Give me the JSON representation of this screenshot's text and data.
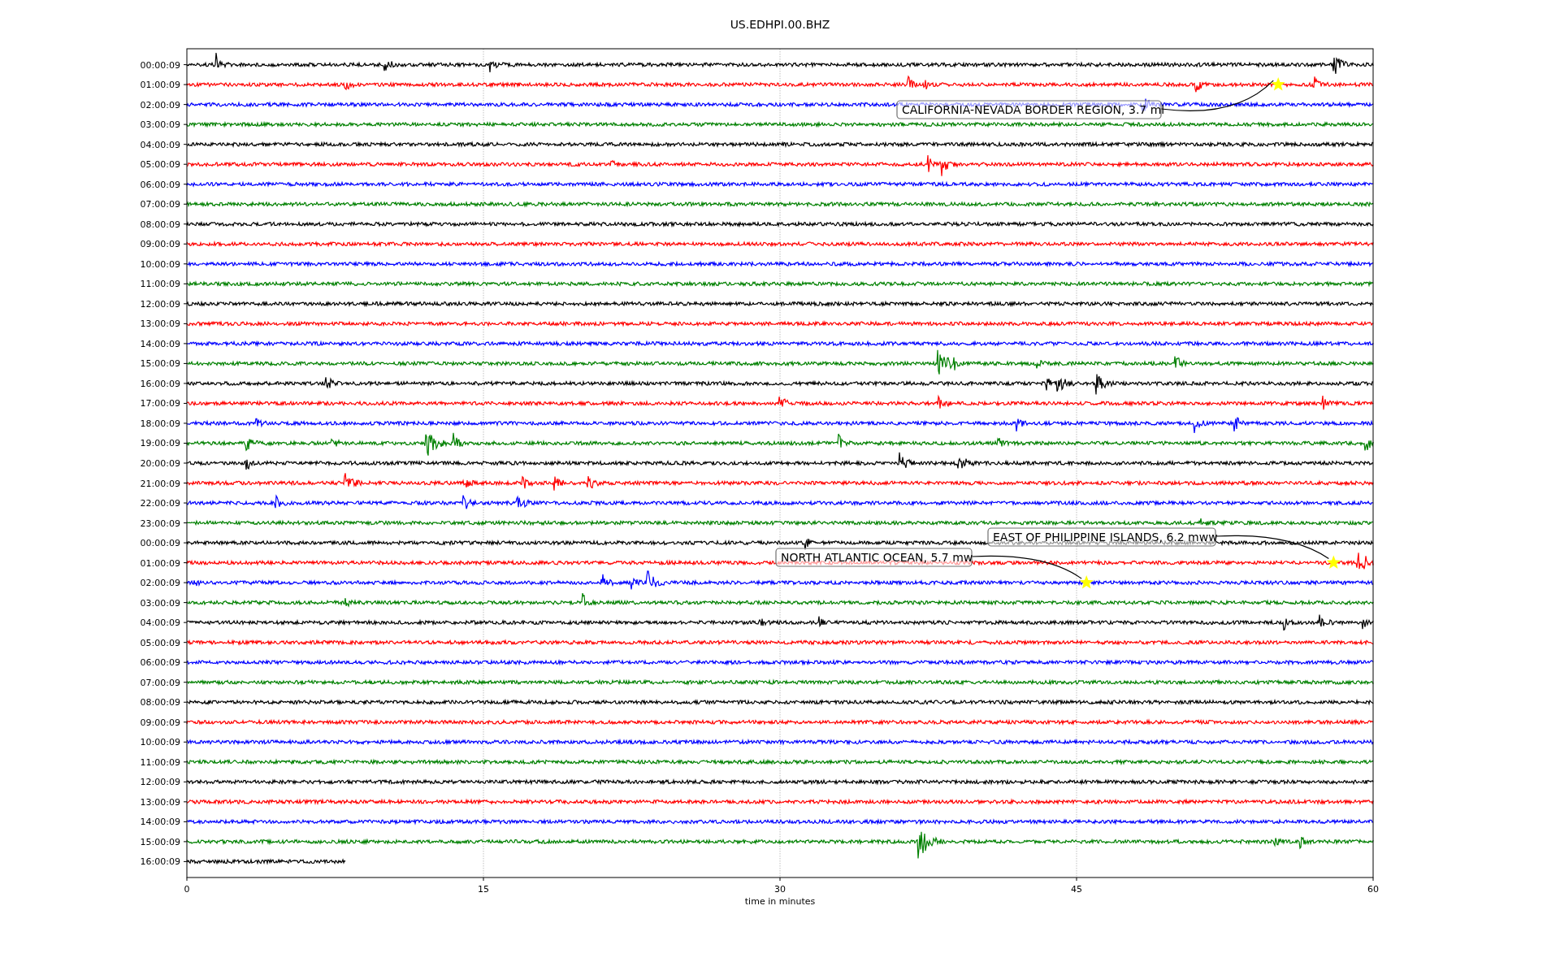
{
  "title": "US.EDHPI.00.BHZ",
  "xlabel": "time in minutes",
  "xticks": [
    "0",
    "15",
    "30",
    "45",
    "60"
  ],
  "rows": [
    {
      "label": "00:00:09",
      "color": "#000000",
      "level": 1
    },
    {
      "label": "01:00:09",
      "color": "#ff0000",
      "level": 1
    },
    {
      "label": "02:00:09",
      "color": "#0000ff",
      "level": 1
    },
    {
      "label": "03:00:09",
      "color": "#008000",
      "level": 1
    },
    {
      "label": "04:00:09",
      "color": "#000000",
      "level": 1
    },
    {
      "label": "05:00:09",
      "color": "#ff0000",
      "level": 1
    },
    {
      "label": "06:00:09",
      "color": "#0000ff",
      "level": 1
    },
    {
      "label": "07:00:09",
      "color": "#008000",
      "level": 1
    },
    {
      "label": "08:00:09",
      "color": "#000000",
      "level": 1
    },
    {
      "label": "09:00:09",
      "color": "#ff0000",
      "level": 1
    },
    {
      "label": "10:00:09",
      "color": "#0000ff",
      "level": 1
    },
    {
      "label": "11:00:09",
      "color": "#008000",
      "level": 1
    },
    {
      "label": "12:00:09",
      "color": "#000000",
      "level": 1
    },
    {
      "label": "13:00:09",
      "color": "#ff0000",
      "level": 1
    },
    {
      "label": "14:00:09",
      "color": "#0000ff",
      "level": 1
    },
    {
      "label": "15:00:09",
      "color": "#008000",
      "level": 1
    },
    {
      "label": "16:00:09",
      "color": "#000000",
      "level": 1
    },
    {
      "label": "17:00:09",
      "color": "#ff0000",
      "level": 1
    },
    {
      "label": "18:00:09",
      "color": "#0000ff",
      "level": 1
    },
    {
      "label": "19:00:09",
      "color": "#008000",
      "level": 1
    },
    {
      "label": "20:00:09",
      "color": "#000000",
      "level": 1
    },
    {
      "label": "21:00:09",
      "color": "#ff0000",
      "level": 1
    },
    {
      "label": "22:00:09",
      "color": "#0000ff",
      "level": 1
    },
    {
      "label": "23:00:09",
      "color": "#008000",
      "level": 1
    },
    {
      "label": "00:00:09",
      "color": "#000000",
      "level": 1
    },
    {
      "label": "01:00:09",
      "color": "#ff0000",
      "level": 1
    },
    {
      "label": "02:00:09",
      "color": "#0000ff",
      "level": 1
    },
    {
      "label": "03:00:09",
      "color": "#008000",
      "level": 1
    },
    {
      "label": "04:00:09",
      "color": "#000000",
      "level": 1
    },
    {
      "label": "05:00:09",
      "color": "#ff0000",
      "level": 1
    },
    {
      "label": "06:00:09",
      "color": "#0000ff",
      "level": 1
    },
    {
      "label": "07:00:09",
      "color": "#008000",
      "level": 1
    },
    {
      "label": "08:00:09",
      "color": "#000000",
      "level": 1
    },
    {
      "label": "09:00:09",
      "color": "#ff0000",
      "level": 1
    },
    {
      "label": "10:00:09",
      "color": "#0000ff",
      "level": 1
    },
    {
      "label": "11:00:09",
      "color": "#008000",
      "level": 1
    },
    {
      "label": "12:00:09",
      "color": "#000000",
      "level": 1
    },
    {
      "label": "13:00:09",
      "color": "#ff0000",
      "level": 1
    },
    {
      "label": "14:00:09",
      "color": "#0000ff",
      "level": 1
    },
    {
      "label": "15:00:09",
      "color": "#008000",
      "level": 1
    },
    {
      "label": "16:00:09",
      "color": "#000000",
      "level": 0.134
    }
  ],
  "events": [
    {
      "text": "CALIFORNIA-NEVADA BORDER REGION, 3.7 ml"
    },
    {
      "text": "EAST OF PHILIPPINE ISLANDS, 6.2 mww"
    },
    {
      "text": "NORTH ATLANTIC OCEAN, 5.7 mw"
    }
  ]
}
